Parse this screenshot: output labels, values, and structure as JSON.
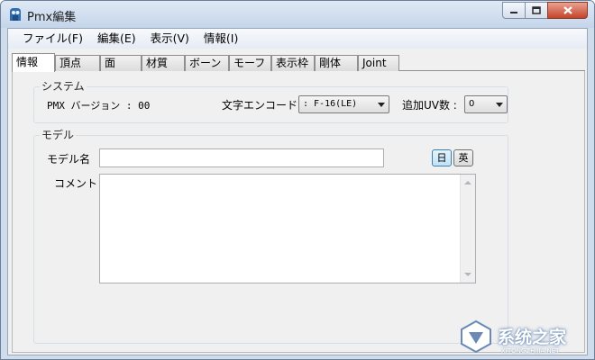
{
  "window": {
    "title": "Pmx編集",
    "colors": {
      "titlebar": "#c4d5ea",
      "close": "#c5432a"
    }
  },
  "menu": [
    {
      "label": "ファイル(F)"
    },
    {
      "label": "編集(E)"
    },
    {
      "label": "表示(V)"
    },
    {
      "label": "情報(I)"
    }
  ],
  "tabs": [
    {
      "label": "情報",
      "active": true
    },
    {
      "label": "頂点"
    },
    {
      "label": "面"
    },
    {
      "label": "材質"
    },
    {
      "label": "ボーン"
    },
    {
      "label": "モーフ"
    },
    {
      "label": "表示枠"
    },
    {
      "label": "剛体"
    },
    {
      "label": "Joint"
    }
  ],
  "system": {
    "title": "システム",
    "version_label": "PMX バージョン : 00",
    "encoding_label": "文字エンコード",
    "encoding_value": ": F-16(LE)",
    "uv_label": "追加UV数 :",
    "uv_value": "0"
  },
  "model": {
    "title": "モデル",
    "name_label": "モデル名",
    "name_value": "",
    "comment_label": "コメント",
    "comment_value": "",
    "lang_jp": "日",
    "lang_en": "英"
  },
  "watermark": {
    "text": "系统之家",
    "url": "XITONGZHIJIA.NET"
  }
}
